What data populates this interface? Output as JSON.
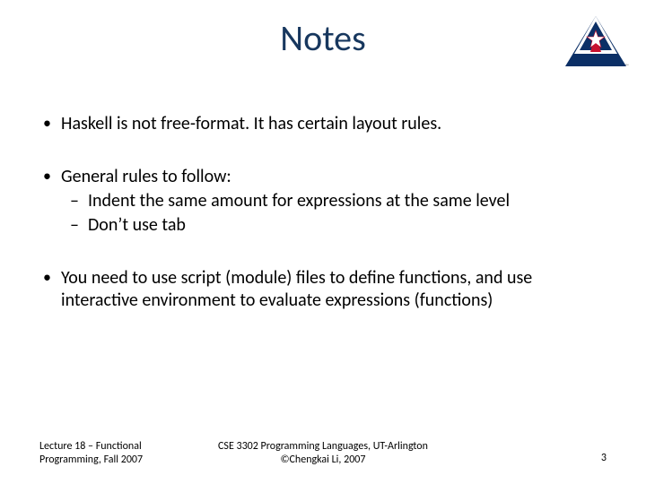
{
  "title": "Notes",
  "logo": {
    "name": "uta-logo"
  },
  "bullets": [
    {
      "text": "Haskell is not free-format. It has certain layout rules."
    },
    {
      "text": "General rules to follow:",
      "sub": [
        "Indent the same amount for expressions at the same level",
        "Don’t use tab"
      ]
    },
    {
      "text": "You need to use script (module) files to define functions, and use interactive environment to evaluate expressions (functions)"
    }
  ],
  "footer": {
    "left_line1": "Lecture 18 – Functional",
    "left_line2": "Programming, Fall 2007",
    "center_line1": "CSE 3302 Programming Languages, UT-Arlington",
    "center_line2": "©Chengkai Li, 2007",
    "page": "3"
  }
}
